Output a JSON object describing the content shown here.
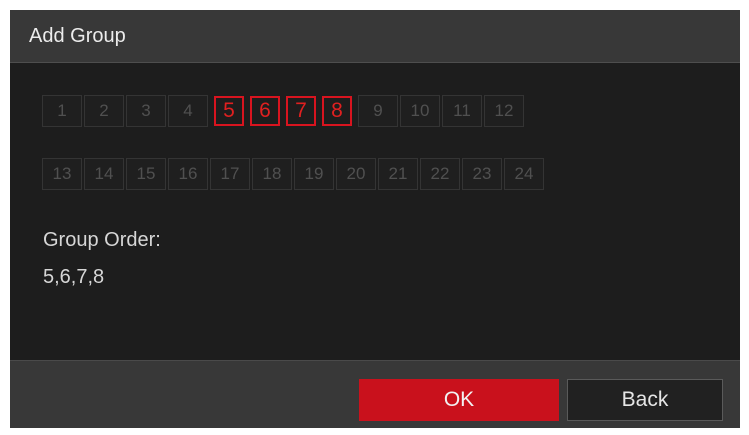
{
  "dialog": {
    "title": "Add Group"
  },
  "channels": {
    "row1": [
      {
        "label": "1",
        "selected": false
      },
      {
        "label": "2",
        "selected": false
      },
      {
        "label": "3",
        "selected": false
      },
      {
        "label": "4",
        "selected": false
      },
      {
        "label": "5",
        "selected": true
      },
      {
        "label": "6",
        "selected": true
      },
      {
        "label": "7",
        "selected": true
      },
      {
        "label": "8",
        "selected": true
      },
      {
        "label": "9",
        "selected": false
      },
      {
        "label": "10",
        "selected": false
      },
      {
        "label": "11",
        "selected": false
      },
      {
        "label": "12",
        "selected": false
      }
    ],
    "row2": [
      {
        "label": "13",
        "selected": false
      },
      {
        "label": "14",
        "selected": false
      },
      {
        "label": "15",
        "selected": false
      },
      {
        "label": "16",
        "selected": false
      },
      {
        "label": "17",
        "selected": false
      },
      {
        "label": "18",
        "selected": false
      },
      {
        "label": "19",
        "selected": false
      },
      {
        "label": "20",
        "selected": false
      },
      {
        "label": "21",
        "selected": false
      },
      {
        "label": "22",
        "selected": false
      },
      {
        "label": "23",
        "selected": false
      },
      {
        "label": "24",
        "selected": false
      }
    ]
  },
  "group_order": {
    "label": "Group Order:",
    "value": "5,6,7,8"
  },
  "footer": {
    "ok_label": "OK",
    "back_label": "Back"
  },
  "colors": {
    "accent": "#c9111c",
    "selected_border": "#d8141f",
    "background": "#1d1d1d",
    "header": "#383838"
  }
}
